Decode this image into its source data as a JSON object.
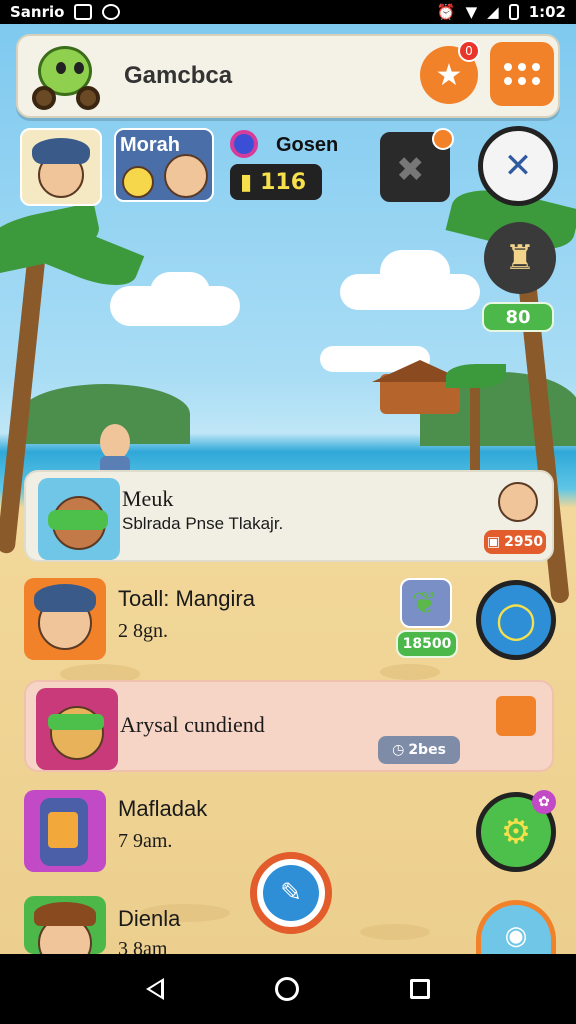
{
  "status_bar": {
    "carrier": "Sanrio",
    "time": "1:02"
  },
  "header": {
    "title": "Gamcbca",
    "star_badge": "0"
  },
  "profiles": {
    "player_one": {
      "name": "Morah"
    },
    "player_two": {
      "name": "Gosen",
      "score": "116"
    },
    "side_level": "80"
  },
  "list": [
    {
      "title": "Meuk",
      "subtitle": "Sblrada Pnse  Tlakajr.",
      "value": "2950"
    },
    {
      "title": "Toall: Mangira",
      "subtitle": "2  8gn.",
      "value": "18500"
    },
    {
      "title": "Arysal cundiend",
      "subtitle": "",
      "value": "2bes"
    },
    {
      "title": "Mafladak",
      "subtitle": "7  9am.",
      "value": ""
    },
    {
      "title": "Dienla",
      "subtitle": "3  8am",
      "value": ""
    }
  ],
  "colors": {
    "accent_orange": "#f2822a",
    "card_light": "#f1efe3",
    "card_pink": "#f7d5c6",
    "green": "#4cb84a",
    "blue": "#2f8fd6"
  }
}
